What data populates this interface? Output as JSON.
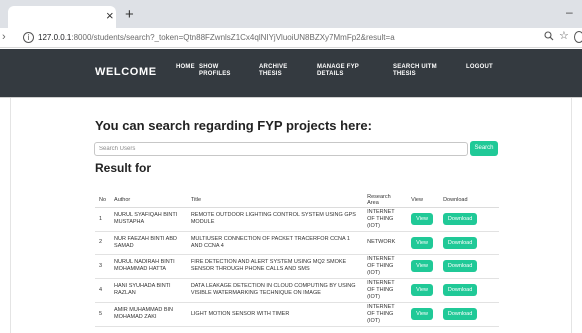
{
  "browser": {
    "tab_close": "×",
    "new_tab": "+",
    "minimize": "–",
    "url_host": "127.0.0.1",
    "url_rest": ":8000/students/search?_token=Qtn88FZwnlsZ1Cx4qlNIYjVluoiUN8BZXy7MmFp2&result=a"
  },
  "nav": {
    "brand": "WELCOME",
    "home": "HOME",
    "show_profiles": "SHOW PROFILES",
    "archive_thesis": "ARCHIVE THESIS",
    "manage_fyp": "MANAGE FYP DETAILS",
    "search_uitm": "SEARCH UITM THESIS",
    "logout": "LOGOUT"
  },
  "main": {
    "heading": "You can search regarding FYP projects here:",
    "search_placeholder": "Search Users",
    "search_button": "Search",
    "result_title": "Result for"
  },
  "table": {
    "headers": {
      "no": "No",
      "author": "Author",
      "title": "Title",
      "area": "Research Area",
      "view": "View",
      "download": "Download"
    },
    "view_label": "View",
    "download_label": "Download",
    "rows": [
      {
        "no": "1",
        "author": "NURUL SYAFIQAH BINTI MUSTAPHA",
        "title": "REMOTE OUTDOOR LIGHTING CONTROL SYSTEM USING GPS MODULE",
        "area": "INTERNET OF THING (IOT)"
      },
      {
        "no": "2",
        "author": "NUR FAEZAH BINTI ABD SAMAD",
        "title": "MULTIUSER CONNECTION OF PACKET TRACERFOR CCNA 1 AND CCNA 4",
        "area": "NETWORK"
      },
      {
        "no": "3",
        "author": "NURUL NADIRAH BINTI MOHAMMAD HATTA",
        "title": "FIRE DETECTION AND ALERT SYSTEM USING MQ2 SMOKE SENSOR THROUGH PHONE CALLS AND SMS",
        "area": "INTERNET OF THING (IOT)"
      },
      {
        "no": "4",
        "author": "HANI SYUHADA BINTI RAZLAN",
        "title": "DATA LEAKAGE DETECTION IN CLOUD COMPUTING BY USING VISIBLE WATERMARKING TECHNIQUE ON IMAGE",
        "area": "INTERNET OF THING (IOT)"
      },
      {
        "no": "5",
        "author": "AMIR MUHAMMAD BIN MOHAMAD ZAKI",
        "title": "LIGHT MOTION SENSOR WITH TIMER",
        "area": "INTERNET OF THING (IOT)"
      }
    ]
  }
}
